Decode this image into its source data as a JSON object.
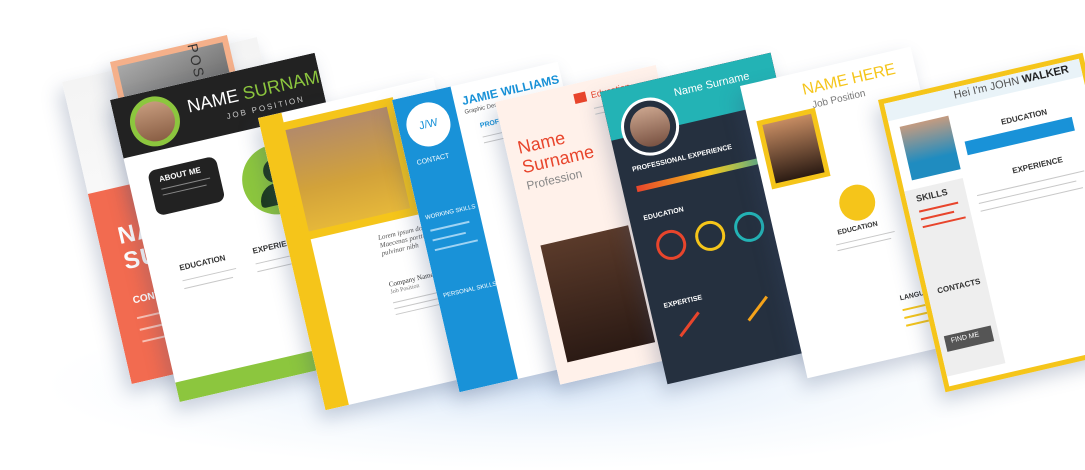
{
  "colors": {
    "coral": "#f26b50",
    "green": "#8cc63e",
    "yellow": "#f5c51a",
    "blue": "#1992d8",
    "navy": "#25303f",
    "teal": "#23b3b5",
    "red": "#e8452c"
  },
  "resume1": {
    "position": "POSITION",
    "name1": "NAME",
    "name2": "SURNAME",
    "contact": "CONTACT"
  },
  "resume2": {
    "name1": "NAME",
    "name2": "SURNAME",
    "job": "JOB POSITION",
    "about": "ABOUT ME",
    "education": "EDUCATION",
    "experience": "EXPERIENCE"
  },
  "resume3": {
    "quote": "Lorem ipsum dolor. Maecenas porttitor and pulvinar nibh",
    "company": "Company Name",
    "position": "Job Position"
  },
  "resume4": {
    "initials": "J/W",
    "name": "JAMIE WILLIAMS",
    "role": "Graphic Designer",
    "profile": "PROFILE",
    "contact": "CONTACT",
    "working_skills": "WORKING SKILLS",
    "personal_skills": "PERSONAL SKILLS"
  },
  "resume5": {
    "name1": "Name",
    "name2": "Surname",
    "profession": "Profession",
    "education": "Education"
  },
  "resume6": {
    "name": "Name Surname",
    "experience": "PROFESSIONAL EXPERIENCE",
    "education": "EDUCATION",
    "expertise": "EXPERTISE"
  },
  "resume7": {
    "name": "NAME HERE",
    "position": "Job Position",
    "education": "EDUCATION",
    "languages": "LANGUAGES"
  },
  "resume8": {
    "greeting": "Hei I'm",
    "first": "JOHN",
    "last": "WALKER",
    "skills": "SKILLS",
    "education": "EDUCATION",
    "experience": "EXPERIENCE",
    "contacts": "CONTACTS",
    "find_me": "FIND ME"
  }
}
